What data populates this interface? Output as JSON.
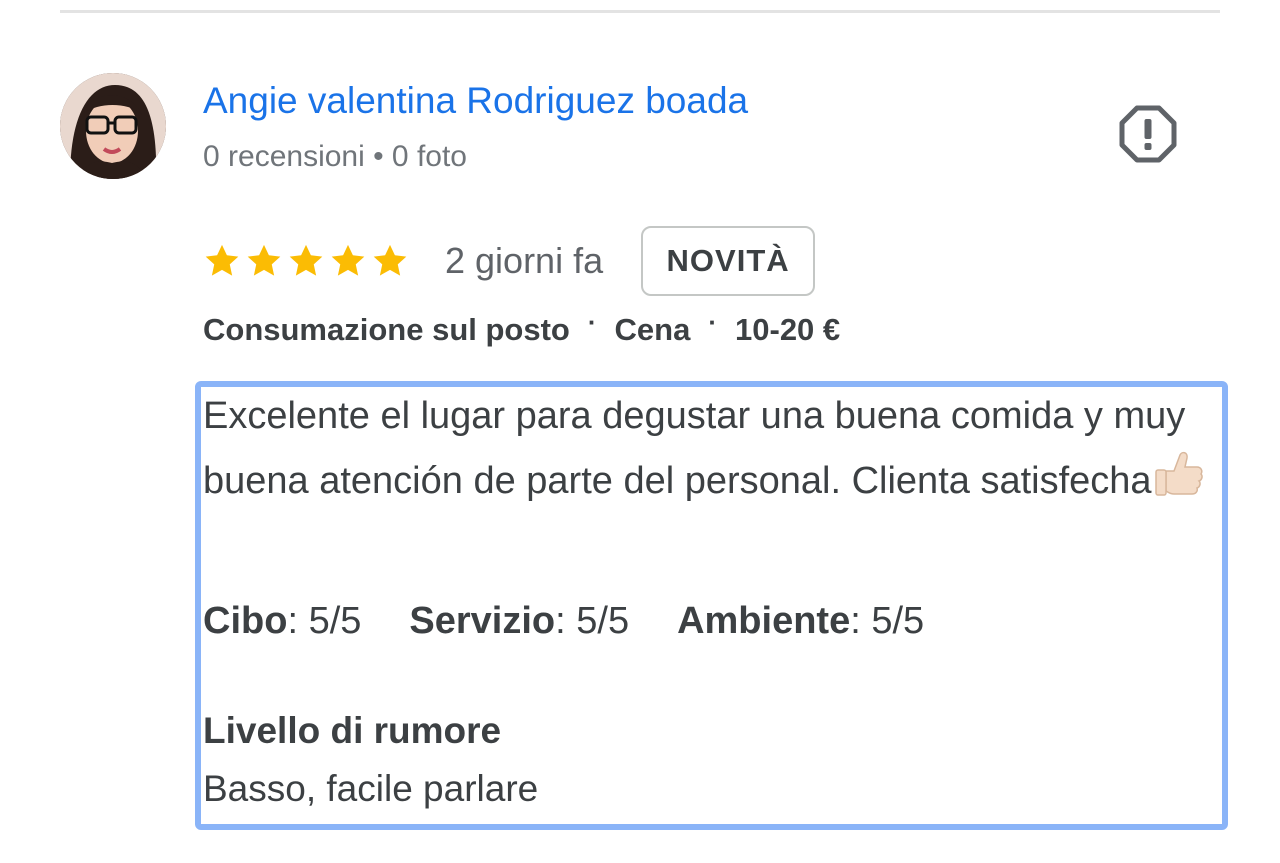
{
  "review": {
    "author": {
      "name": "Angie valentina Rodriguez boada",
      "meta": "0 recensioni • 0 foto"
    },
    "rating": 5,
    "max_rating": 5,
    "time_ago": "2 giorni fa",
    "badge": "NOVITÀ",
    "visit_info": [
      "Consumazione sul posto",
      "Cena",
      "10-20 €"
    ],
    "visit_separator": "·",
    "text": "Excelente el lugar para degustar una buena comida y muy buena atención de parte del personal. Clienta satisfecha",
    "sub_ratings": [
      {
        "label": "Cibo",
        "value": "5/5"
      },
      {
        "label": "Servizio",
        "value": "5/5"
      },
      {
        "label": "Ambiente",
        "value": "5/5"
      }
    ],
    "noise": {
      "title": "Livello di rumore",
      "value": "Basso, facile parlare"
    }
  },
  "icons": {
    "star": "star-icon",
    "report": "report-flag-icon",
    "thumb": "thumbs-up-emoji"
  },
  "colors": {
    "link": "#1a73e8",
    "star": "#fbbc04",
    "focus_border": "#8ab4f8",
    "badge_border": "#c4c7c5"
  }
}
